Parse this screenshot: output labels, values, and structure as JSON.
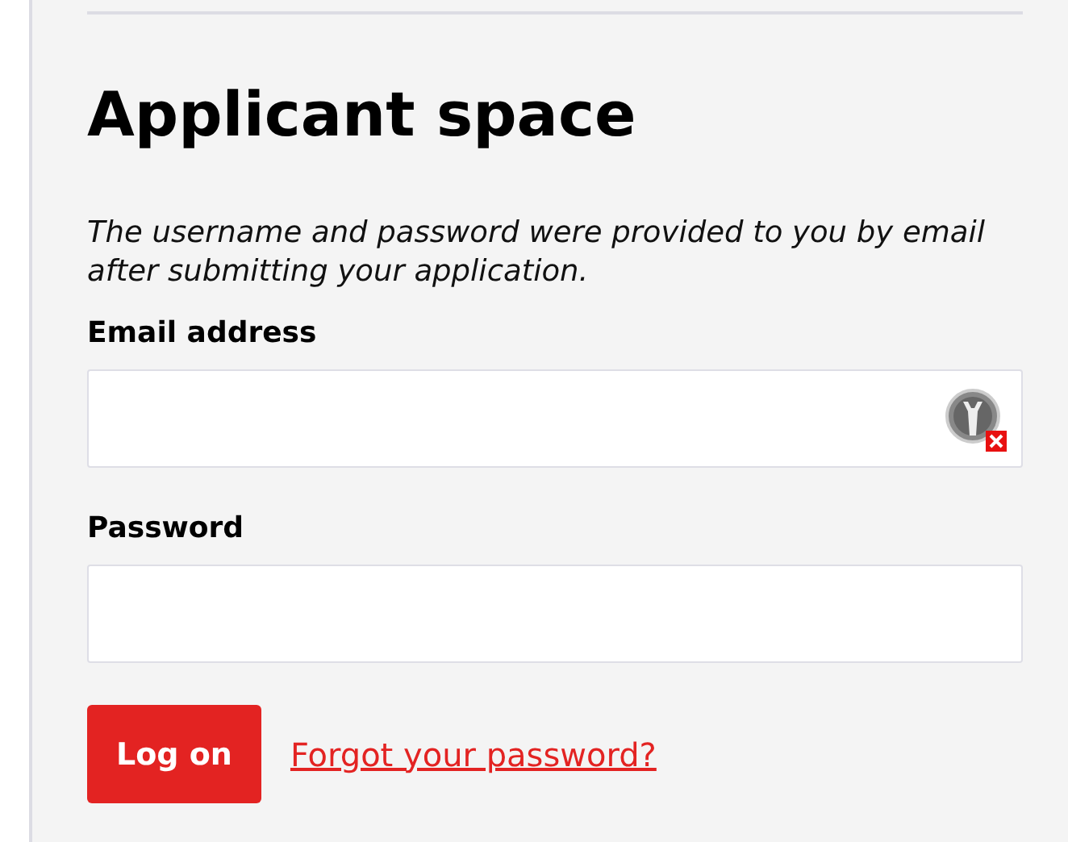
{
  "title": "Applicant space",
  "intro": "The username and password were provided to you by email after submitting your application.",
  "fields": [
    {
      "label": "Email address",
      "key_icon": true
    },
    {
      "label": "Password",
      "key_icon": false
    }
  ],
  "submit": "Log on",
  "forgot_link": "Forgot your password?"
}
